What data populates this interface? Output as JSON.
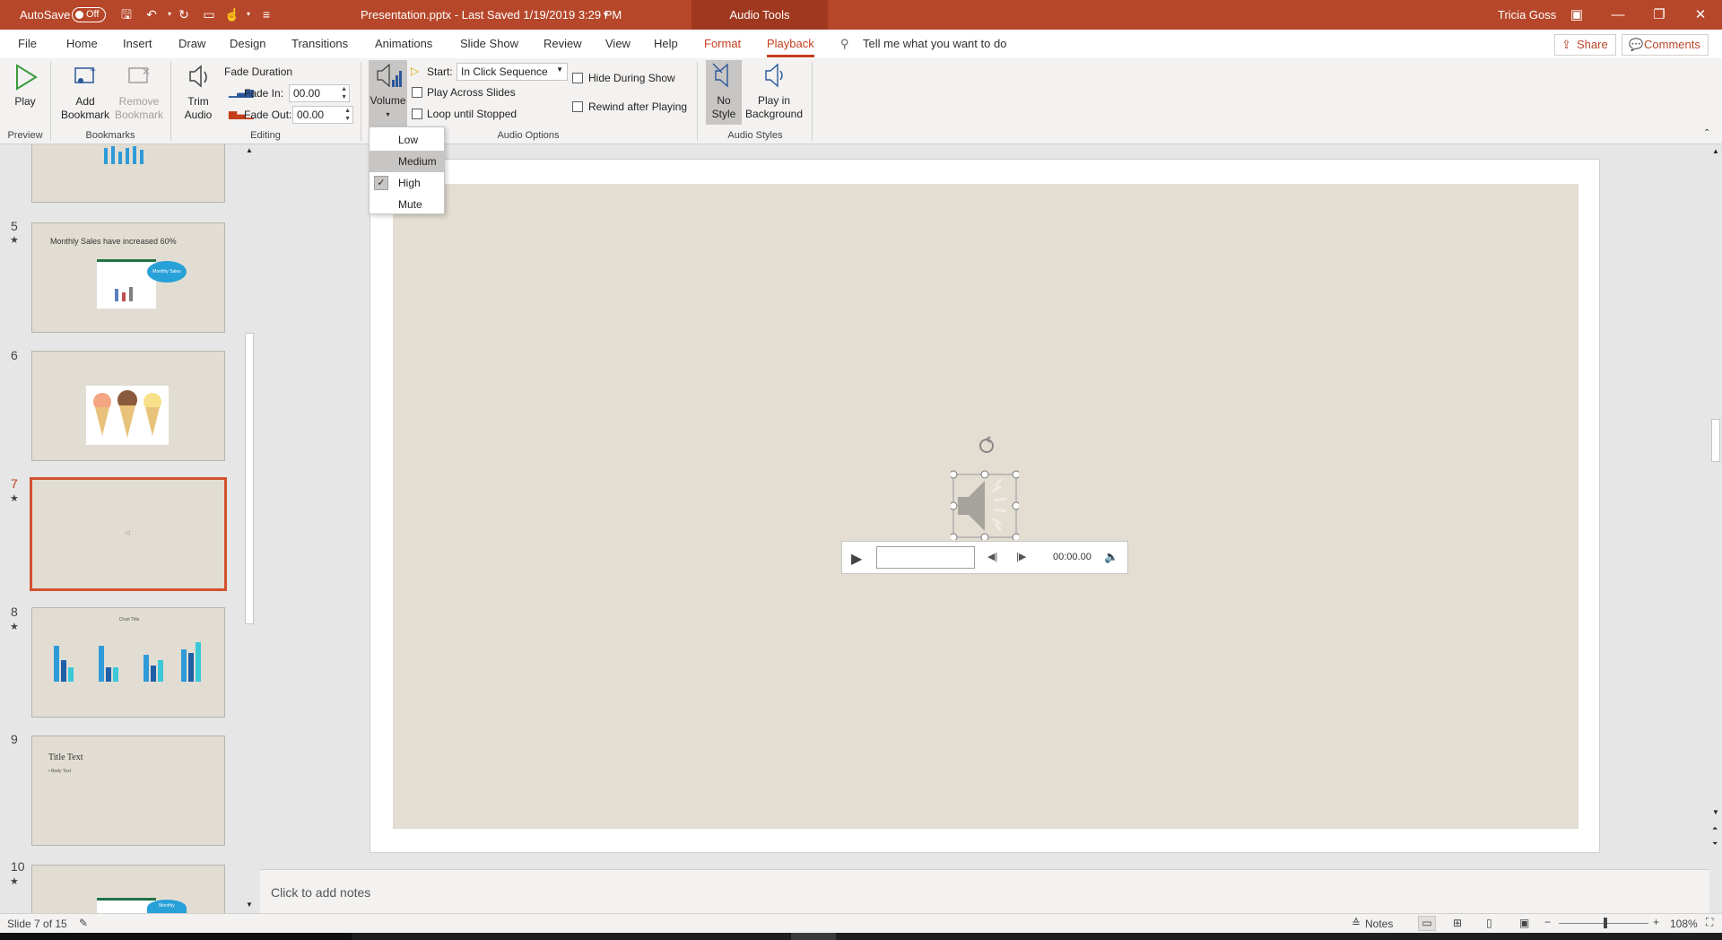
{
  "titlebar": {
    "autosave_label": "AutoSave",
    "autosave_state": "Off",
    "doc_title": "Presentation.pptx  -  Last Saved 1/19/2019 3:29 PM",
    "contextual_tab": "Audio Tools",
    "user": "Tricia Goss",
    "color": "#b7472a"
  },
  "tabs": [
    "File",
    "Home",
    "Insert",
    "Draw",
    "Design",
    "Transitions",
    "Animations",
    "Slide Show",
    "Review",
    "View",
    "Help",
    "Format",
    "Playback"
  ],
  "active_tab": "Playback",
  "tell_me": "Tell me what you want to do",
  "share_label": "Share",
  "comments_label": "Comments",
  "ribbon": {
    "preview": {
      "play": "Play",
      "group": "Preview"
    },
    "bookmarks": {
      "add": [
        "Add",
        "Bookmark"
      ],
      "remove": [
        "Remove",
        "Bookmark"
      ],
      "group": "Bookmarks"
    },
    "editing": {
      "trim": [
        "Trim",
        "Audio"
      ],
      "fade_duration": "Fade Duration",
      "fade_in_label": "Fade In:",
      "fade_in": "00.00",
      "fade_out_label": "Fade Out:",
      "fade_out": "00.00",
      "group": "Editing"
    },
    "audio_options": {
      "volume": "Volume",
      "start_label": "Start:",
      "start_value": "In Click Sequence",
      "play_across": "Play Across Slides",
      "loop": "Loop until Stopped",
      "hide": "Hide During Show",
      "rewind": "Rewind after Playing",
      "group": "Audio Options"
    },
    "audio_styles": {
      "no_style": [
        "No",
        "Style"
      ],
      "play_bg": [
        "Play in",
        "Background"
      ],
      "group": "Audio Styles"
    }
  },
  "volume_menu": {
    "items": [
      "Low",
      "Medium",
      "High",
      "Mute"
    ],
    "checked": "High",
    "hover": "Medium"
  },
  "slides": [
    {
      "num": "5",
      "star": true,
      "title": "Monthly Sales have increased 60%",
      "callout": "Monthly Sales"
    },
    {
      "num": "6",
      "star": false
    },
    {
      "num": "7",
      "star": true
    },
    {
      "num": "8",
      "star": true,
      "title": "Chart Title"
    },
    {
      "num": "9",
      "star": false,
      "title": "Title Text",
      "body": "• Body Text"
    },
    {
      "num": "10",
      "star": true,
      "callout": "Monthly"
    }
  ],
  "player": {
    "time": "00:00.00"
  },
  "notes_placeholder": "Click to add notes",
  "status": {
    "slide": "Slide 7 of 15",
    "notes": "Notes",
    "zoom": "108%"
  }
}
